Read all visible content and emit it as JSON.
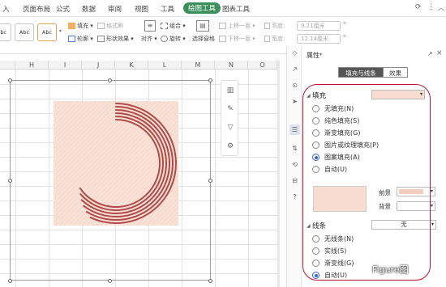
{
  "menubar": {
    "items": [
      "入",
      "页面布局",
      "公式",
      "数据",
      "审阅",
      "视图",
      "工具",
      "绘图工具",
      "图表工具"
    ],
    "active_index": 7
  },
  "ribbon": {
    "style_presets": [
      "Abc",
      "Abc",
      "Abc"
    ],
    "fill": "填充",
    "format_brush": "格式刷",
    "outline": "轮廓",
    "shape_effect": "形状效果",
    "align": "对齐",
    "group": "组合",
    "rotate": "旋转",
    "select_pane": "选择窗格",
    "bring_forward": "上移一层",
    "send_backward": "下移一层",
    "height_label": "高度:",
    "height_value": "9.21厘米",
    "width_label": "宽度:",
    "width_value": "12.14厘米"
  },
  "sheet": {
    "columns": [
      "H",
      "I",
      "J",
      "K",
      "L",
      "M",
      "N",
      "O"
    ]
  },
  "shape": {
    "fill_color": "#f7dccf",
    "ring_color": "#b04a48",
    "float_toolbar_icons": [
      "chart-icon",
      "pen-icon",
      "filter-icon",
      "settings-icon"
    ]
  },
  "panel": {
    "title": "属性",
    "tabs": [
      "填充与线条",
      "效果"
    ],
    "active_tab": 0,
    "fill_section": "填充",
    "fill_options": [
      "无填充(N)",
      "纯色填充(S)",
      "渐变填充(G)",
      "图片或纹理填充(P)",
      "图案填充(A)",
      "自动(U)"
    ],
    "fill_selected": 4,
    "foreground_label": "前景",
    "background_label": "背景",
    "line_section": "线条",
    "line_value": "无",
    "line_options": [
      "无线条(N)",
      "实线(S)",
      "渐变线(G)",
      "自动(U)"
    ],
    "line_selected": 3,
    "pattern_color": "#f3cdbd"
  },
  "watermark": "Figure图",
  "accent": "#3a8f5a",
  "highlight": "#c1122a"
}
